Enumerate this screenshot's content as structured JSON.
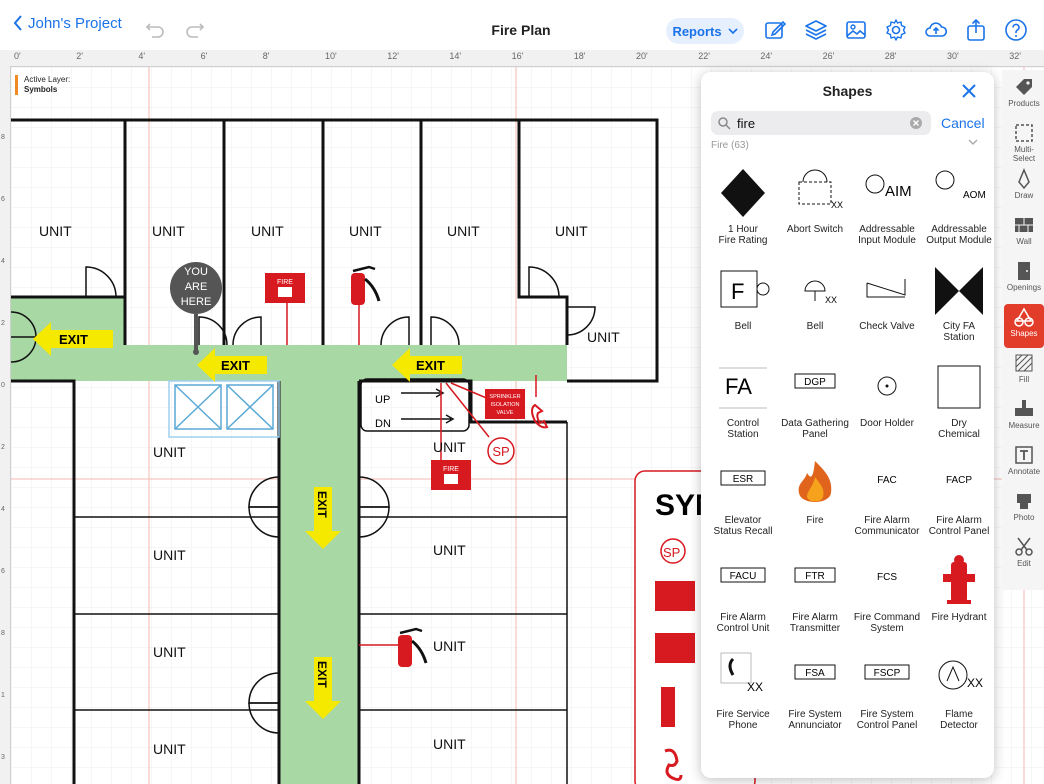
{
  "header": {
    "back_label": "John's Project",
    "title": "Fire Plan",
    "reports_label": "Reports"
  },
  "ruler": {
    "top_labels": [
      "0'",
      "2'",
      "4'",
      "6'",
      "8'",
      "10'",
      "12'",
      "14'",
      "16'",
      "18'",
      "20'",
      "22'",
      "24'",
      "26'",
      "28'",
      "30'",
      "32'"
    ],
    "left_labels": [
      "8",
      "6",
      "4",
      "2",
      "0",
      "2",
      "4",
      "6",
      "8",
      "1",
      "3"
    ]
  },
  "canvas": {
    "active_layer_label": "Active Layer:",
    "active_layer_value": "Symbols",
    "units": [
      "UNIT",
      "UNIT",
      "UNIT",
      "UNIT",
      "UNIT",
      "UNIT",
      "UNIT",
      "UNIT",
      "UNIT",
      "UNIT",
      "UNIT",
      "UNIT",
      "UNIT",
      "UNIT",
      "UNIT"
    ],
    "you_are_here": [
      "YOU",
      "ARE",
      "HERE"
    ],
    "exit_label": "EXIT",
    "stairs_up": "UP",
    "stairs_dn": "DN",
    "fire_box_text": "FIRE",
    "sprinkler_text": [
      "SPRINKLER",
      "ISOLATION",
      "VALVE"
    ],
    "sp_label": "SP",
    "legend_title": "SYM"
  },
  "panel": {
    "title": "Shapes",
    "search_value": "fire",
    "cancel_label": "Cancel",
    "section_label": "Fire (63)",
    "shapes": [
      {
        "label": "1 Hour\nFire Rating",
        "icon": "diamond-icon"
      },
      {
        "label": "Abort Switch",
        "icon": "abort-switch-icon"
      },
      {
        "label": "Addressable\nInput Module",
        "icon": "aim-icon"
      },
      {
        "label": "Addressable\nOutput Module",
        "icon": "aom-icon"
      },
      {
        "label": "Bell",
        "icon": "bell-f-icon"
      },
      {
        "label": "Bell",
        "icon": "bell-icon"
      },
      {
        "label": "Check Valve",
        "icon": "check-valve-icon"
      },
      {
        "label": "City FA\nStation",
        "icon": "bowtie-icon"
      },
      {
        "label": "Control\nStation",
        "icon": "fa-icon"
      },
      {
        "label": "Data Gathering\nPanel",
        "icon": "dgp-icon"
      },
      {
        "label": "Door Holder",
        "icon": "door-holder-icon"
      },
      {
        "label": "Dry\nChemical",
        "icon": "square-icon"
      },
      {
        "label": "Elevator\nStatus Recall",
        "icon": "esr-icon"
      },
      {
        "label": "Fire",
        "icon": "flame-icon"
      },
      {
        "label": "Fire Alarm\nCommunicator",
        "icon": "fac-icon"
      },
      {
        "label": "Fire Alarm\nControl Panel",
        "icon": "facp-icon"
      },
      {
        "label": "Fire Alarm\nControl Unit",
        "icon": "facu-icon"
      },
      {
        "label": "Fire Alarm\nTransmitter",
        "icon": "ftr-icon"
      },
      {
        "label": "Fire Command\nSystem",
        "icon": "fcs-icon"
      },
      {
        "label": "Fire Hydrant",
        "icon": "hydrant-icon"
      },
      {
        "label": "Fire Service\nPhone",
        "icon": "phone-xx-icon"
      },
      {
        "label": "Fire System\nAnnunciator",
        "icon": "fsa-icon"
      },
      {
        "label": "Fire System\nControl Panel",
        "icon": "fscp-icon"
      },
      {
        "label": "Flame\nDetector",
        "icon": "flame-detector-icon"
      }
    ],
    "shape_texts": {
      "aim": "AIM",
      "aom": "AOM",
      "fa": "FA",
      "dgp": "DGP",
      "esr": "ESR",
      "fac": "FAC",
      "facp": "FACP",
      "facu": "FACU",
      "ftr": "FTR",
      "fcs": "FCS",
      "fsa": "FSA",
      "fscp": "FSCP",
      "xx": "XX",
      "f": "F"
    }
  },
  "tools": [
    {
      "label": "Products",
      "icon": "tag-icon"
    },
    {
      "label": "Multi-\nSelect",
      "icon": "multi-select-icon"
    },
    {
      "label": "Draw",
      "icon": "pen-icon"
    },
    {
      "label": "Wall",
      "icon": "wall-icon"
    },
    {
      "label": "Openings",
      "icon": "door-icon"
    },
    {
      "label": "Shapes",
      "icon": "shapes-icon"
    },
    {
      "label": "Fill",
      "icon": "fill-icon"
    },
    {
      "label": "Measure",
      "icon": "measure-icon"
    },
    {
      "label": "Annotate",
      "icon": "text-icon"
    },
    {
      "label": "Photo",
      "icon": "camera-icon"
    },
    {
      "label": "Edit",
      "icon": "scissors-icon"
    }
  ],
  "colors": {
    "accent": "#1a73e8",
    "active_tool": "#e23c2a",
    "corridor": "#a8d8a3",
    "exit_sign": "#f5e900",
    "fire_red": "#d71920"
  }
}
